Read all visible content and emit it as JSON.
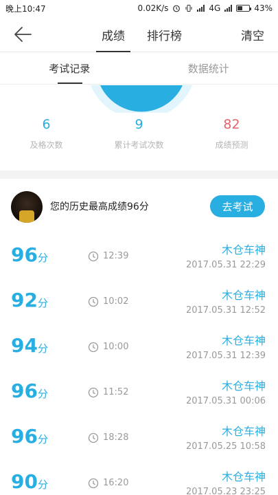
{
  "status_bar": {
    "time": "晚上10:47",
    "speed": "0.02K/s",
    "network": "4G",
    "battery_text": "43%",
    "battery_level": 0.43
  },
  "nav": {
    "tabs": [
      {
        "label": "成绩",
        "active": true
      },
      {
        "label": "排行榜",
        "active": false
      }
    ],
    "right_label": "清空"
  },
  "sub_tabs": [
    {
      "label": "考试记录",
      "active": true
    },
    {
      "label": "数据统计",
      "active": false
    }
  ],
  "stats": [
    {
      "value": "6",
      "label": "及格次数",
      "color": "#29aee2"
    },
    {
      "value": "9",
      "label": "累计考试次数",
      "color": "#29aee2"
    },
    {
      "value": "82",
      "label": "成绩预测",
      "color": "#e8636a"
    }
  ],
  "best": {
    "text": "您的历史最高成绩96分",
    "button_label": "去考试"
  },
  "records": [
    {
      "score": "96",
      "unit": "分",
      "duration": "12:39",
      "user": "木仓车神",
      "date": "2017.05.31  22:29"
    },
    {
      "score": "92",
      "unit": "分",
      "duration": "10:02",
      "user": "木仓车神",
      "date": "2017.05.31  12:52"
    },
    {
      "score": "94",
      "unit": "分",
      "duration": "10:00",
      "user": "木仓车神",
      "date": "2017.05.31  12:39"
    },
    {
      "score": "96",
      "unit": "分",
      "duration": "11:52",
      "user": "木仓车神",
      "date": "2017.05.31  00:06"
    },
    {
      "score": "96",
      "unit": "分",
      "duration": "18:28",
      "user": "木仓车神",
      "date": "2017.05.25  10:58"
    },
    {
      "score": "90",
      "unit": "分",
      "duration": "16:20",
      "user": "木仓车神",
      "date": "2017.05.23  23:25"
    }
  ],
  "colors": {
    "accent": "#29aee2",
    "prediction": "#e8636a"
  }
}
